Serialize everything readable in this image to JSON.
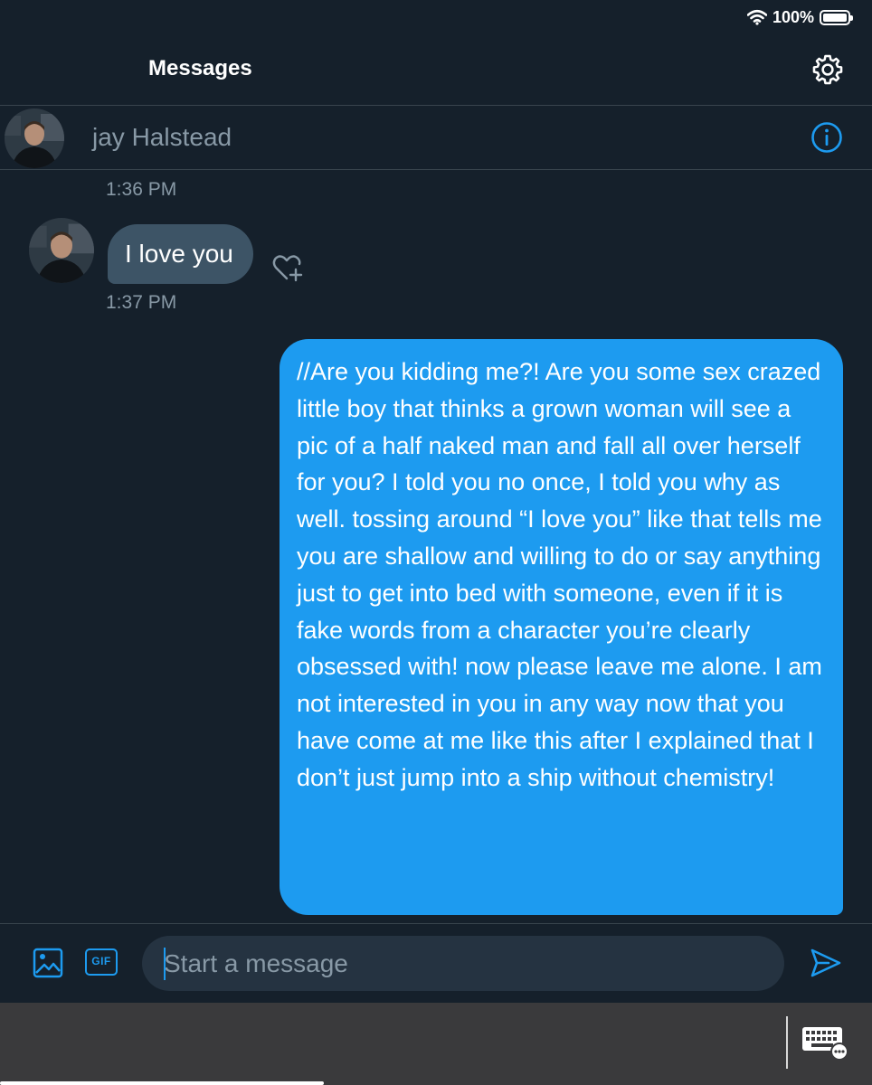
{
  "status_bar": {
    "battery_percent": "100%",
    "battery_level": 1.0,
    "icons": [
      "wifi-icon",
      "battery-icon"
    ]
  },
  "header": {
    "title": "Messages",
    "settings_icon": "gear-icon"
  },
  "conversation": {
    "name": "jay Halstead",
    "info_icon": "info-icon"
  },
  "messages": [
    {
      "type": "timestamp",
      "text": "1:36 PM"
    },
    {
      "type": "incoming",
      "text": "I love you",
      "react_icon": "heart-plus-icon"
    },
    {
      "type": "timestamp",
      "text": "1:37 PM"
    },
    {
      "type": "outgoing",
      "text": "//Are you kidding me?! Are you some sex crazed little boy that thinks a grown woman will see a pic of a half naked man and fall all over herself for you? I told you no once, I told you why as well. tossing around “I love you” like that tells me you are shallow and willing to do or say anything just to get into bed with someone, even if it is fake words from a character you’re clearly obsessed with! now please leave me alone. I am not interested in you in any way now that you have come at me like this after I explained that I don’t just jump into a ship without chemistry!"
    }
  ],
  "composer": {
    "media_icon": "image-icon",
    "gif_label": "GIF",
    "placeholder": "Start a message",
    "value": "",
    "send_icon": "send-icon"
  },
  "keyboard_bar": {
    "icon": "keyboard-icon"
  },
  "colors": {
    "background": "#15202b",
    "accent": "#1d9bf0",
    "incoming_bubble": "#3d5466",
    "muted_text": "#8899a6",
    "divider": "#38444d"
  }
}
